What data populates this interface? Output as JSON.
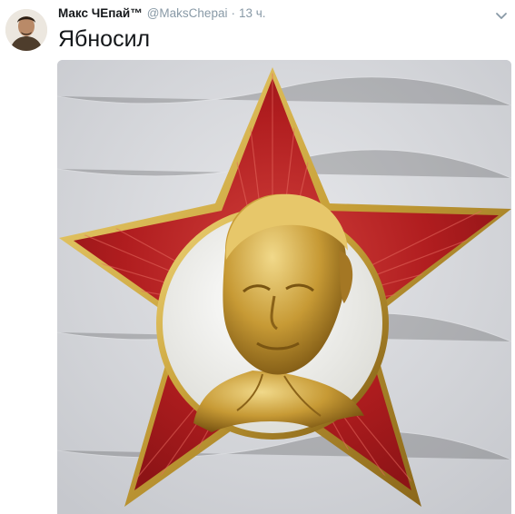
{
  "tweet": {
    "display_name": "Макс ЧЕпай™",
    "handle": "@MaksChepai",
    "separator": "·",
    "timestamp": "13 ч.",
    "text": "Ябносил"
  },
  "icons": {
    "avatar": "avatar",
    "menu": "chevron-down-icon"
  },
  "media": {
    "kind": "photo",
    "subject": "star-badge"
  },
  "colors": {
    "name": "#14171a",
    "meta": "#8899a6",
    "star_red": "#b01d1f",
    "gold": "#c9a23a",
    "enamel": "#f3f3ef"
  }
}
